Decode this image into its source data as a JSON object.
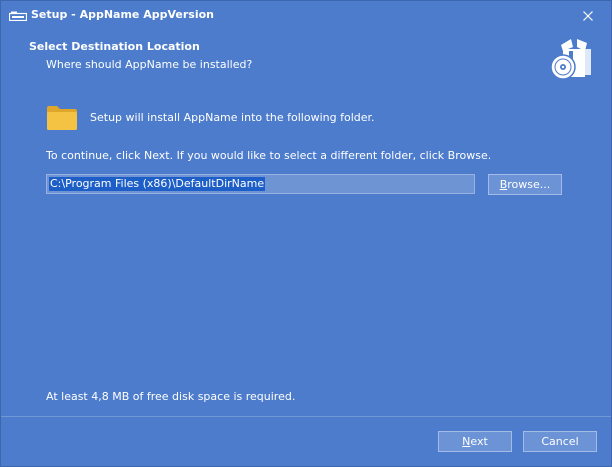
{
  "window": {
    "title": "Setup - AppName AppVersion"
  },
  "header": {
    "title": "Select Destination Location",
    "subtitle": "Where should AppName be installed?"
  },
  "body": {
    "install_text": "Setup will install AppName into the following folder.",
    "continue_text": "To continue, click Next. If you would like to select a different folder, click Browse.",
    "dir_value": "C:\\Program Files (x86)\\DefaultDirName",
    "browse_accel": "B",
    "browse_rest": "rowse...",
    "disk_space_text": "At least 4,8 MB of free disk space is required."
  },
  "footer": {
    "next_accel": "N",
    "next_rest": "ext",
    "cancel_label": "Cancel"
  },
  "icons": {
    "app": "setup-app-icon",
    "close": "close-icon",
    "wizard": "setup-box-disc-icon",
    "folder": "folder-icon"
  },
  "colors": {
    "background": "#4c7ccb",
    "button": "#6b93d6",
    "input": "#6f94d4",
    "selection": "#1d5fc6",
    "folder": "#f5c343"
  }
}
